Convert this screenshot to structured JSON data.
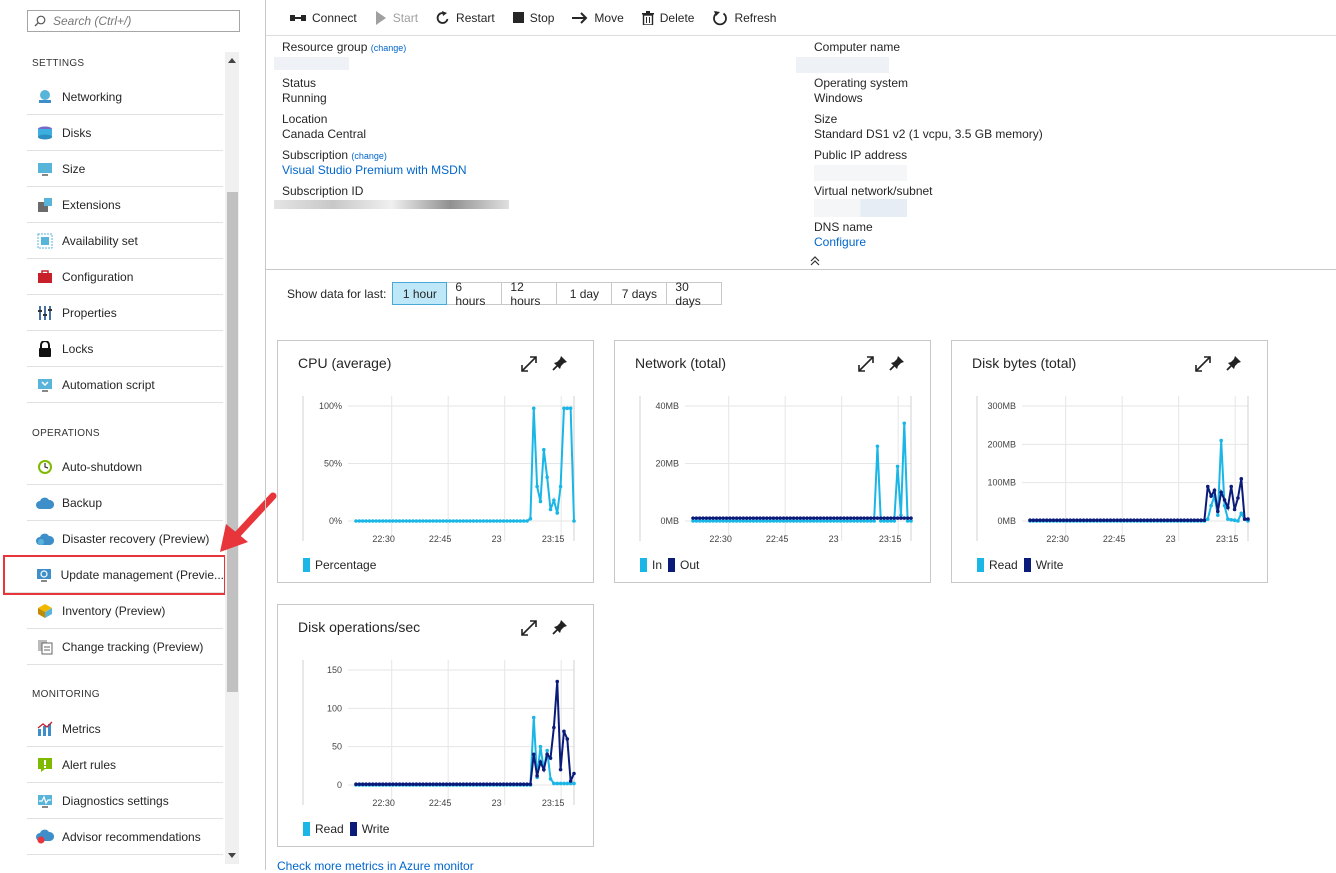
{
  "search": {
    "placeholder": "Search (Ctrl+/)"
  },
  "sidebar": {
    "settings_label": "SETTINGS",
    "settings": [
      {
        "label": "Networking",
        "icon": "networking-icon"
      },
      {
        "label": "Disks",
        "icon": "disks-icon"
      },
      {
        "label": "Size",
        "icon": "size-icon"
      },
      {
        "label": "Extensions",
        "icon": "extensions-icon"
      },
      {
        "label": "Availability set",
        "icon": "availability-set-icon"
      },
      {
        "label": "Configuration",
        "icon": "configuration-icon"
      },
      {
        "label": "Properties",
        "icon": "properties-icon"
      },
      {
        "label": "Locks",
        "icon": "lock-icon"
      },
      {
        "label": "Automation script",
        "icon": "automation-script-icon"
      }
    ],
    "operations_label": "OPERATIONS",
    "operations": [
      {
        "label": "Auto-shutdown",
        "icon": "clock-icon"
      },
      {
        "label": "Backup",
        "icon": "cloud-backup-icon"
      },
      {
        "label": "Disaster recovery (Preview)",
        "icon": "cloud-recovery-icon"
      },
      {
        "label": "Update management (Previe...",
        "icon": "update-management-icon"
      },
      {
        "label": "Inventory (Preview)",
        "icon": "inventory-icon"
      },
      {
        "label": "Change tracking (Preview)",
        "icon": "change-tracking-icon"
      }
    ],
    "monitoring_label": "MONITORING",
    "monitoring": [
      {
        "label": "Metrics",
        "icon": "metrics-icon"
      },
      {
        "label": "Alert rules",
        "icon": "alert-icon"
      },
      {
        "label": "Diagnostics settings",
        "icon": "diagnostics-icon"
      },
      {
        "label": "Advisor recommendations",
        "icon": "advisor-icon"
      }
    ]
  },
  "toolbar": {
    "connect": "Connect",
    "start": "Start",
    "restart": "Restart",
    "stop": "Stop",
    "move": "Move",
    "delete": "Delete",
    "refresh": "Refresh"
  },
  "essentials": {
    "resource_group_label": "Resource group",
    "change": "(change)",
    "status_label": "Status",
    "status": "Running",
    "location_label": "Location",
    "location": "Canada Central",
    "subscription_label": "Subscription",
    "subscription": "Visual Studio Premium with MSDN",
    "subscription_id_label": "Subscription ID",
    "computer_name_label": "Computer name",
    "os_label": "Operating system",
    "os": "Windows",
    "size_label": "Size",
    "size": "Standard DS1 v2 (1 vcpu, 3.5 GB memory)",
    "public_ip_label": "Public IP address",
    "vnet_label": "Virtual network/subnet",
    "dns_label": "DNS name",
    "dns": "Configure"
  },
  "timerange": {
    "label": "Show data for last:",
    "options": [
      "1 hour",
      "6 hours",
      "12 hours",
      "1 day",
      "7 days",
      "30 days"
    ],
    "selected": "1 hour"
  },
  "colors": {
    "light": "#1ab6e6",
    "dark": "#0b1b7a",
    "accent": "#0066cc",
    "highlight": "#e8353b"
  },
  "x_ticks": [
    "22:30",
    "22:45",
    "23",
    "23:15"
  ],
  "chart_data": [
    {
      "type": "line",
      "title": "CPU (average)",
      "y_ticks": [
        "100%",
        "50%",
        "0%"
      ],
      "ylim": [
        0,
        100
      ],
      "series": [
        {
          "name": "Percentage",
          "color": "#1ab6e6",
          "values": [
            0,
            0,
            0,
            0,
            0,
            0,
            0,
            0,
            0,
            0,
            0,
            0,
            0,
            0,
            0,
            0,
            0,
            0,
            0,
            0,
            0,
            0,
            0,
            0,
            0,
            0,
            0,
            0,
            0,
            0,
            0,
            0,
            0,
            0,
            0,
            0,
            0,
            0,
            0,
            0,
            0,
            0,
            0,
            0,
            0,
            0,
            0,
            0,
            0,
            0,
            0,
            0,
            2,
            98,
            30,
            17,
            62,
            38,
            10,
            18,
            7,
            30,
            98,
            98,
            98,
            0
          ]
        }
      ]
    },
    {
      "type": "line",
      "title": "Network (total)",
      "y_ticks": [
        "40MB",
        "20MB",
        "0MB"
      ],
      "ylim": [
        0,
        40
      ],
      "series": [
        {
          "name": "In",
          "color": "#1ab6e6",
          "values": [
            0,
            0,
            0,
            0,
            0,
            0,
            0,
            0,
            0,
            0,
            0,
            0,
            0,
            0,
            0,
            0,
            0,
            0,
            0,
            0,
            0,
            0,
            0,
            0,
            0,
            0,
            0,
            0,
            0,
            0,
            0,
            0,
            0,
            0,
            0,
            0,
            0,
            0,
            0,
            0,
            0,
            0,
            0,
            0,
            0,
            0,
            0,
            0,
            0,
            0,
            0,
            0,
            0,
            0,
            0,
            26,
            0,
            0,
            0,
            0,
            0,
            19,
            2,
            34,
            0,
            0
          ]
        },
        {
          "name": "Out",
          "color": "#0b1b7a",
          "values": [
            1,
            1,
            1,
            1,
            1,
            1,
            1,
            1,
            1,
            1,
            1,
            1,
            1,
            1,
            1,
            1,
            1,
            1,
            1,
            1,
            1,
            1,
            1,
            1,
            1,
            1,
            1,
            1,
            1,
            1,
            1,
            1,
            1,
            1,
            1,
            1,
            1,
            1,
            1,
            1,
            1,
            1,
            1,
            1,
            1,
            1,
            1,
            1,
            1,
            1,
            1,
            1,
            1,
            1,
            1,
            1,
            1,
            1,
            1,
            1,
            1,
            1,
            1,
            1,
            1,
            1
          ]
        }
      ]
    },
    {
      "type": "line",
      "title": "Disk bytes (total)",
      "y_ticks": [
        "300MB",
        "200MB",
        "100MB",
        "0MB"
      ],
      "ylim": [
        0,
        300
      ],
      "series": [
        {
          "name": "Read",
          "color": "#1ab6e6",
          "values": [
            0,
            0,
            0,
            0,
            0,
            0,
            0,
            0,
            0,
            0,
            0,
            0,
            0,
            0,
            0,
            0,
            0,
            0,
            0,
            0,
            0,
            0,
            0,
            0,
            0,
            0,
            0,
            0,
            0,
            0,
            0,
            0,
            0,
            0,
            0,
            0,
            0,
            0,
            0,
            0,
            0,
            0,
            0,
            0,
            0,
            0,
            0,
            0,
            0,
            0,
            0,
            0,
            0,
            5,
            40,
            65,
            15,
            210,
            40,
            5,
            3,
            2,
            0,
            20,
            5,
            0
          ]
        },
        {
          "name": "Write",
          "color": "#0b1b7a",
          "values": [
            2,
            2,
            2,
            2,
            2,
            2,
            2,
            2,
            2,
            2,
            2,
            2,
            2,
            2,
            2,
            2,
            2,
            2,
            2,
            2,
            2,
            2,
            2,
            2,
            2,
            2,
            2,
            2,
            2,
            2,
            2,
            2,
            2,
            2,
            2,
            2,
            2,
            2,
            2,
            2,
            2,
            2,
            2,
            2,
            2,
            2,
            2,
            2,
            2,
            2,
            2,
            2,
            2,
            90,
            65,
            80,
            25,
            75,
            55,
            35,
            90,
            30,
            60,
            110,
            5,
            5
          ]
        }
      ]
    },
    {
      "type": "line",
      "title": "Disk operations/sec",
      "y_ticks": [
        "150",
        "100",
        "50",
        "0"
      ],
      "ylim": [
        0,
        150
      ],
      "series": [
        {
          "name": "Read",
          "color": "#1ab6e6",
          "values": [
            0,
            0,
            0,
            0,
            0,
            0,
            0,
            0,
            0,
            0,
            0,
            0,
            0,
            0,
            0,
            0,
            0,
            0,
            0,
            0,
            0,
            0,
            0,
            0,
            0,
            0,
            0,
            0,
            0,
            0,
            0,
            0,
            0,
            0,
            0,
            0,
            0,
            0,
            0,
            0,
            0,
            0,
            0,
            0,
            0,
            0,
            0,
            0,
            0,
            0,
            0,
            0,
            0,
            88,
            10,
            50,
            20,
            45,
            8,
            2,
            2,
            2,
            2,
            2,
            2,
            2
          ]
        },
        {
          "name": "Write",
          "color": "#0b1b7a",
          "values": [
            1,
            1,
            1,
            1,
            1,
            1,
            1,
            1,
            1,
            1,
            1,
            1,
            1,
            1,
            1,
            1,
            1,
            1,
            1,
            1,
            1,
            1,
            1,
            1,
            1,
            1,
            1,
            1,
            1,
            1,
            1,
            1,
            1,
            1,
            1,
            1,
            1,
            1,
            1,
            1,
            1,
            1,
            1,
            1,
            1,
            1,
            1,
            1,
            1,
            1,
            1,
            1,
            1,
            40,
            12,
            30,
            20,
            40,
            35,
            75,
            135,
            20,
            70,
            60,
            5,
            15
          ]
        }
      ]
    }
  ],
  "more_link": "Check more metrics in Azure monitor"
}
